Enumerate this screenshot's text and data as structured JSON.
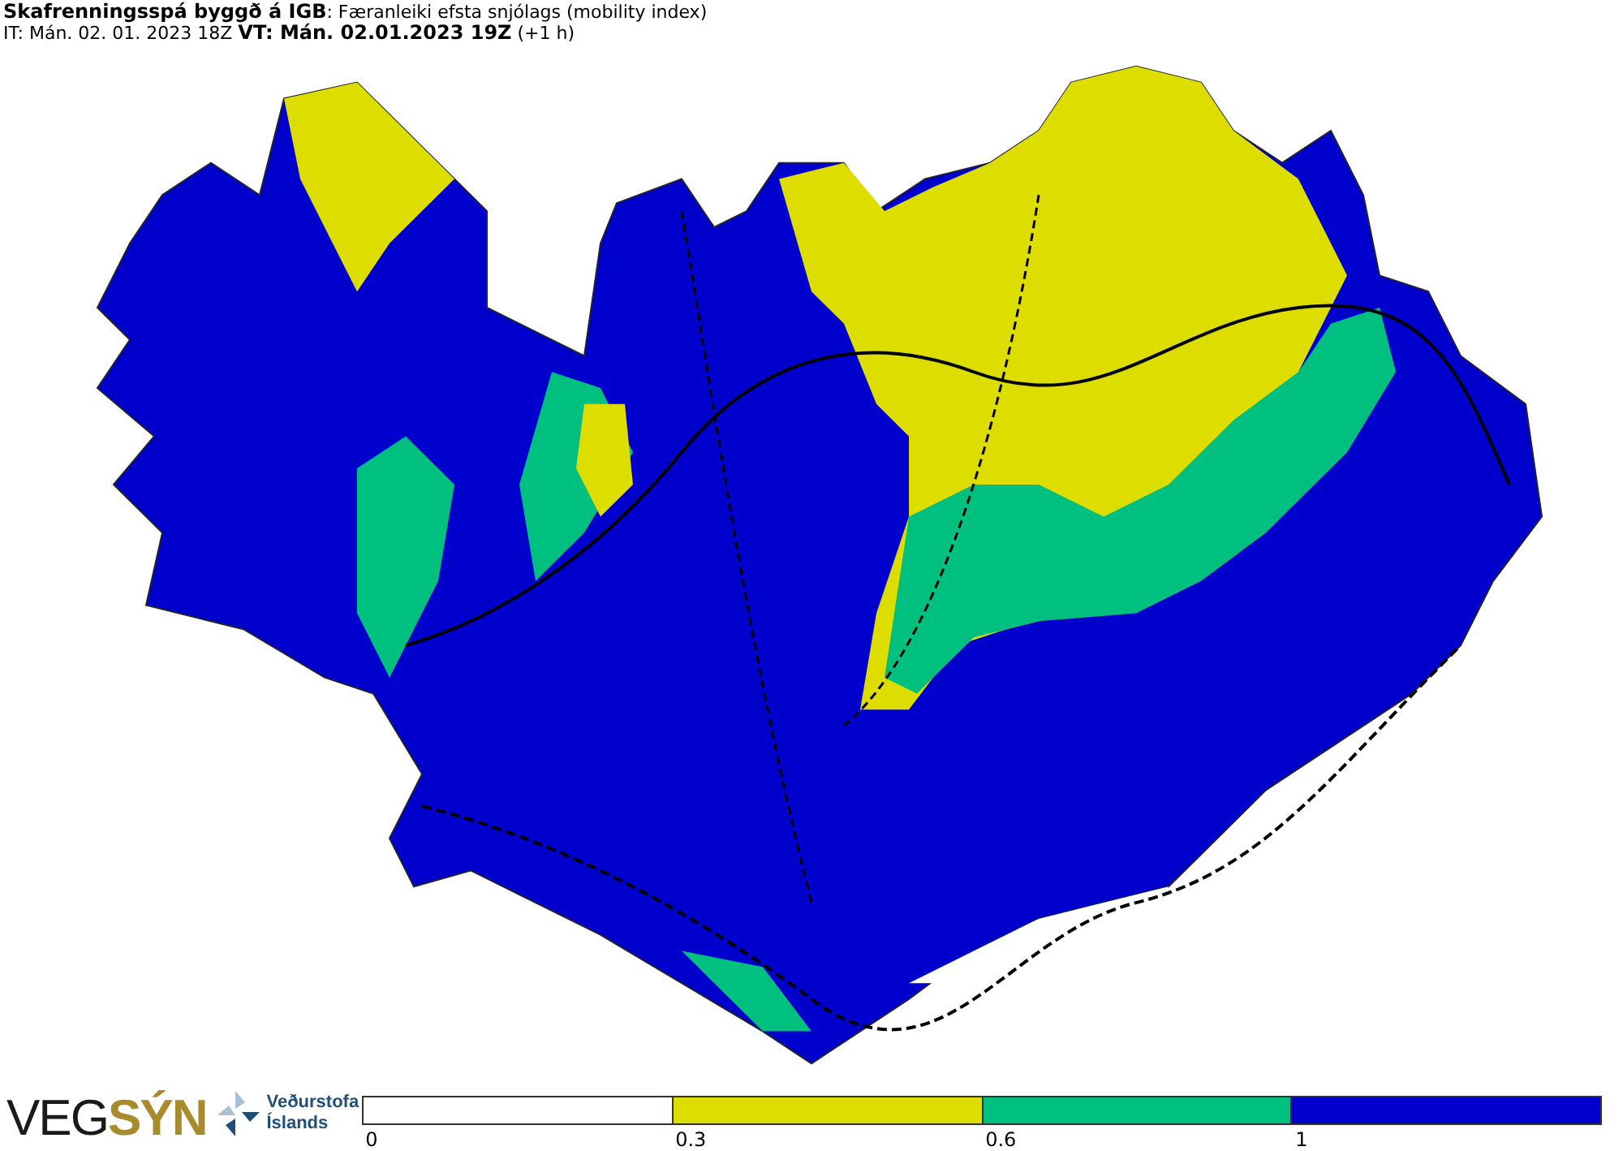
{
  "header": {
    "title": "**Skafrenningsspá byggð á IGB**: Færanleiki efsta snjólags (mobility index)",
    "subtitle": "IT: Mán. 02. 01. 2023 18Z **VT: Mán. 02.01.2023 19Z** (+1 h)"
  },
  "footer": {
    "vegsyn_logo": {
      "part_1": "VEG",
      "part_2": "SÝN"
    },
    "vedurstofa_logo": {
      "line_1": "Veðurstofa",
      "line_2": "Íslands"
    },
    "legend": {
      "bins": [
        {
          "color": "#ffffff"
        },
        {
          "color": "#dddd00"
        },
        {
          "color": "#00c080"
        },
        {
          "color": "#0000cc"
        }
      ],
      "ticks": [
        "0",
        "0.3",
        "0.6",
        "1"
      ]
    }
  }
}
